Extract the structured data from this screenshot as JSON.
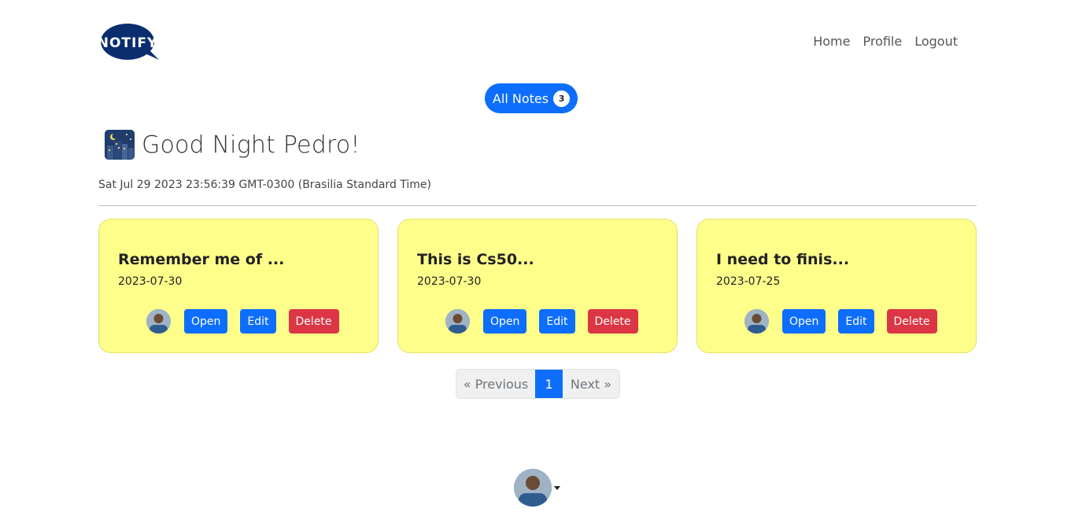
{
  "brand": {
    "logo_text": "NOTIFY",
    "color": "#0a2d6e"
  },
  "nav": {
    "items": [
      "Home",
      "Profile",
      "Logout"
    ]
  },
  "all_notes": {
    "label": "All Notes",
    "count": "3"
  },
  "greeting": {
    "text": "Good Night Pedro!",
    "icon": "night-city-icon"
  },
  "timestamp": "Sat Jul 29 2023 23:56:39 GMT-0300 (Brasilia Standard Time)",
  "notes": [
    {
      "title": "Remember me of ...",
      "date": "2023-07-30",
      "open": "Open",
      "edit": "Edit",
      "delete": "Delete"
    },
    {
      "title": "This is Cs50...",
      "date": "2023-07-30",
      "open": "Open",
      "edit": "Edit",
      "delete": "Delete"
    },
    {
      "title": "I need to finis...",
      "date": "2023-07-25",
      "open": "Open",
      "edit": "Edit",
      "delete": "Delete"
    }
  ],
  "pagination": {
    "previous": "« Previous",
    "current": "1",
    "next": "Next »"
  },
  "colors": {
    "primary": "#0d6efd",
    "danger": "#dc3545",
    "note_bg": "#feff8b"
  }
}
